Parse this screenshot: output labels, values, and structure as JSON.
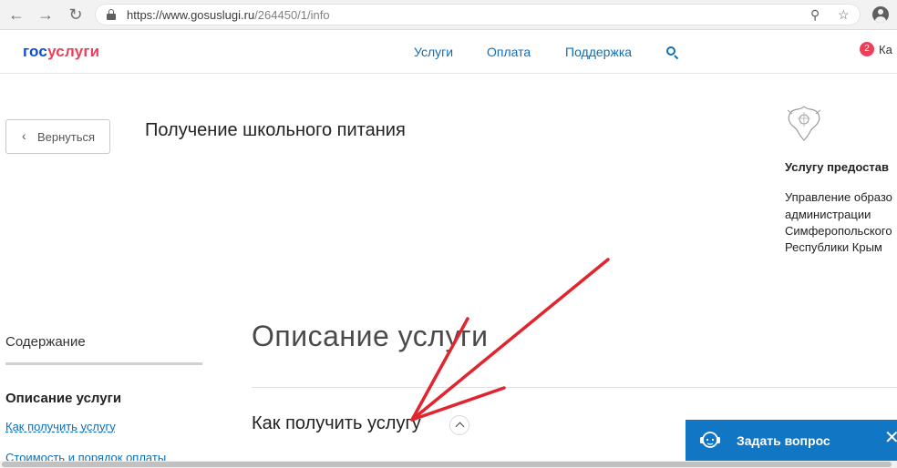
{
  "browser": {
    "url_host": "https://www.gosuslugi.ru",
    "url_path": "/264450/1/info",
    "back_icon": "arrow-left-icon",
    "forward_icon": "arrow-right-icon",
    "reload_icon": "reload-icon",
    "zoom_icon": "magnifier-icon",
    "bookmark_icon": "star-icon",
    "profile_icon": "account-icon"
  },
  "header": {
    "logo_part1": "гос",
    "logo_part2": "услуги",
    "menu": [
      {
        "label": "Услуги"
      },
      {
        "label": "Оплата"
      },
      {
        "label": "Поддержка"
      }
    ],
    "notification_count": "2",
    "cabinet_label": "Ка"
  },
  "back_button": {
    "label": "Вернуться"
  },
  "page_title": "Получение школьного питания",
  "provider": {
    "heading": "Услугу предостав",
    "lines": [
      "Управление образо",
      "администрации",
      "Симферопольского",
      "Республики Крым"
    ]
  },
  "toc": {
    "title": "Содержание",
    "active": "Описание услуги",
    "links": [
      {
        "label": "Как получить услугу"
      },
      {
        "label": "Стоимость и порядок оплаты"
      }
    ]
  },
  "main": {
    "section_title": "Описание услуги",
    "subheading": "Как получить услугу"
  },
  "ask_widget": {
    "label": "Задать вопрос",
    "close": "✕"
  },
  "colors": {
    "brand_blue": "#0d4cd3",
    "brand_red": "#ee3f58",
    "link_blue": "#0d6fb8",
    "widget_blue": "#1176c4",
    "annotation_red": "#e0252f"
  }
}
